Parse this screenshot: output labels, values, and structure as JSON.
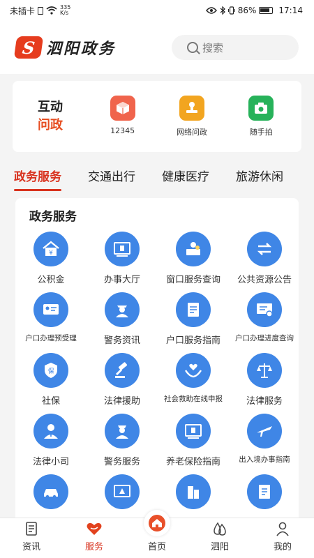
{
  "status_bar": {
    "carrier": "未插卡",
    "net_speed_value": "335",
    "net_speed_unit": "K/s",
    "battery": "86%",
    "time": "17:14"
  },
  "header": {
    "logo_mark": "S",
    "app_name": "泗阳政务",
    "search_placeholder": "搜索"
  },
  "interact": {
    "title_line1": "互动",
    "title_line2": "问政",
    "items": [
      {
        "label": "12345",
        "icon": "cube-icon",
        "color": "#f0644c"
      },
      {
        "label": "网络问政",
        "icon": "stamp-icon",
        "color": "#f2a520"
      },
      {
        "label": "随手拍",
        "icon": "camera-icon",
        "color": "#27b25a"
      }
    ]
  },
  "tabs": [
    "政务服务",
    "交通出行",
    "健康医疗",
    "旅游休闲"
  ],
  "services": {
    "title": "政务服务",
    "items": [
      {
        "label": "公积金",
        "icon": "house-fund-icon"
      },
      {
        "label": "办事大厅",
        "icon": "hall-icon"
      },
      {
        "label": "窗口服务查询",
        "icon": "window-service-icon"
      },
      {
        "label": "公共资源公告",
        "icon": "exchange-icon"
      },
      {
        "label": "户口办理预受理",
        "icon": "id-card-icon"
      },
      {
        "label": "警务资讯",
        "icon": "police-icon"
      },
      {
        "label": "户口服务指南",
        "icon": "guide-icon"
      },
      {
        "label": "户口办理进度查询",
        "icon": "progress-query-icon"
      },
      {
        "label": "社保",
        "icon": "social-security-icon"
      },
      {
        "label": "法律援助",
        "icon": "gavel-icon"
      },
      {
        "label": "社会救助在线申报",
        "icon": "heart-hands-icon"
      },
      {
        "label": "法律服务",
        "icon": "scales-icon"
      },
      {
        "label": "法律小司",
        "icon": "lawyer-icon"
      },
      {
        "label": "警务服务",
        "icon": "police-service-icon"
      },
      {
        "label": "养老保险指南",
        "icon": "pension-icon"
      },
      {
        "label": "出入境办事指南",
        "icon": "airplane-icon"
      },
      {
        "label": "",
        "icon": "car-icon"
      },
      {
        "label": "",
        "icon": "warning-board-icon"
      },
      {
        "label": "",
        "icon": "building-icon"
      },
      {
        "label": "",
        "icon": "document-icon"
      }
    ]
  },
  "bottom_nav": [
    {
      "label": "资讯",
      "icon": "news-icon",
      "active": false
    },
    {
      "label": "服务",
      "icon": "heart-service-icon",
      "active": true
    },
    {
      "label": "首页",
      "icon": "home-icon",
      "active": false
    },
    {
      "label": "泗阳",
      "icon": "drops-icon",
      "active": false
    },
    {
      "label": "我的",
      "icon": "user-icon",
      "active": false
    }
  ],
  "colors": {
    "brand_red": "#d8321e",
    "service_blue": "#3f86e6"
  }
}
